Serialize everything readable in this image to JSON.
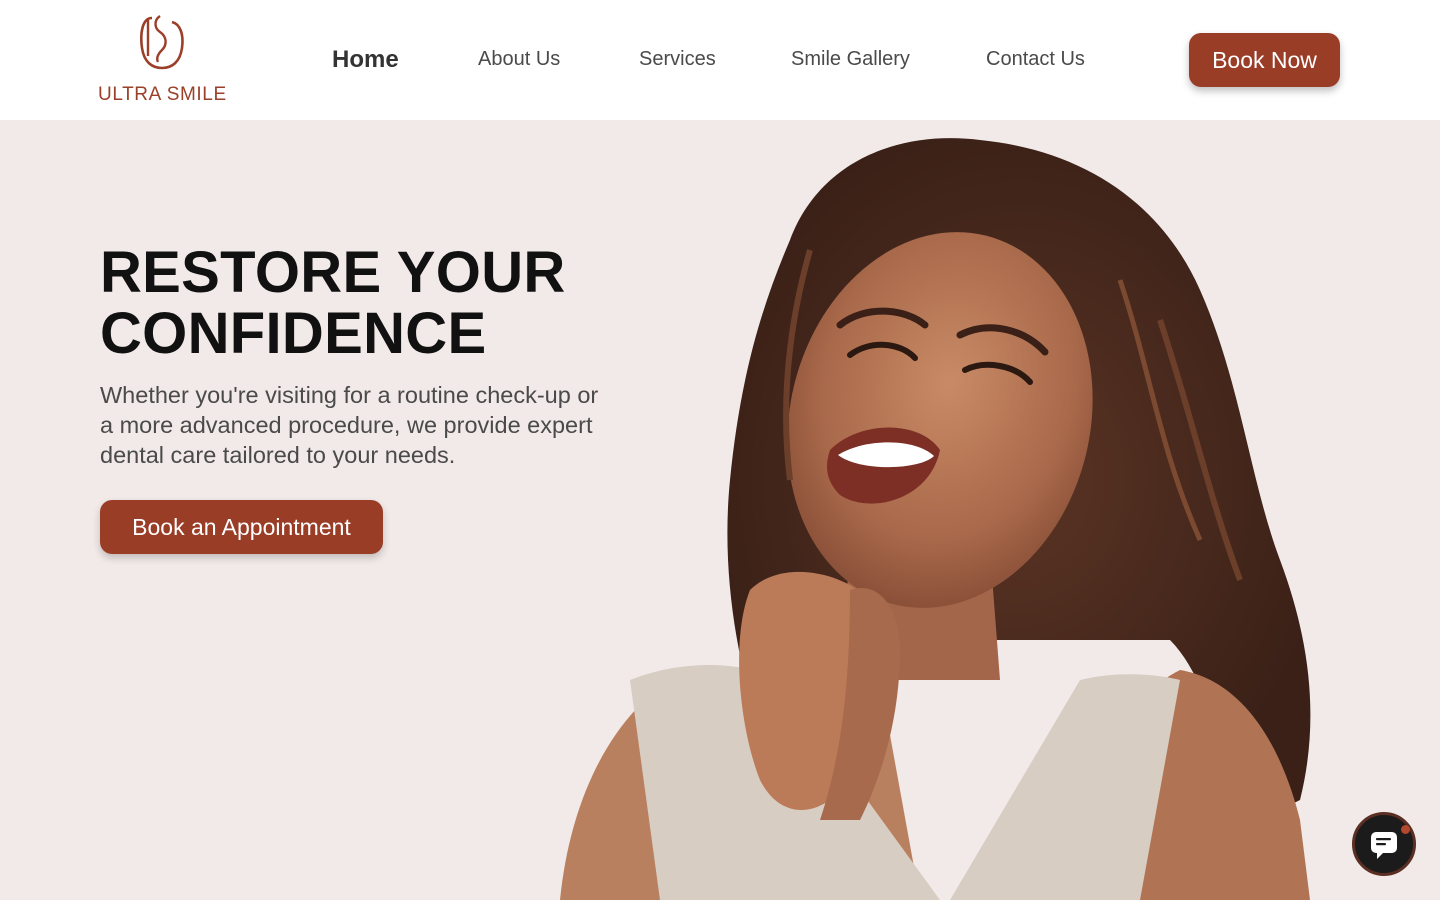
{
  "brand": {
    "name": "ULTRA SMILE",
    "color": "#9a3d27"
  },
  "nav": {
    "items": [
      {
        "label": "Home",
        "active": true
      },
      {
        "label": "About Us",
        "active": false
      },
      {
        "label": "Services",
        "active": false
      },
      {
        "label": "Smile Gallery",
        "active": false
      },
      {
        "label": "Contact Us",
        "active": false
      }
    ],
    "cta_label": "Book Now"
  },
  "hero": {
    "headline_line1": "RESTORE YOUR",
    "headline_line2": "CONFIDENCE",
    "subtext": "Whether you're visiting for a routine check-up or a more advanced procedure, we provide expert dental care tailored to your needs.",
    "cta_label": "Book an Appointment",
    "image": "smiling-woman-portrait",
    "background": "#f2eae8"
  },
  "chat": {
    "icon": "chat-icon",
    "has_notification": true
  }
}
